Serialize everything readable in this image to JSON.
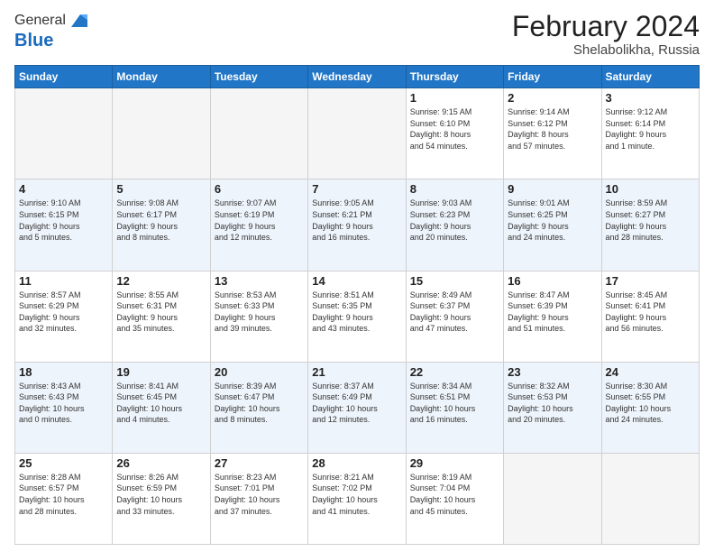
{
  "logo": {
    "general": "General",
    "blue": "Blue"
  },
  "header": {
    "title": "February 2024",
    "subtitle": "Shelabolikha, Russia"
  },
  "weekdays": [
    "Sunday",
    "Monday",
    "Tuesday",
    "Wednesday",
    "Thursday",
    "Friday",
    "Saturday"
  ],
  "weeks": [
    [
      {
        "day": "",
        "info": ""
      },
      {
        "day": "",
        "info": ""
      },
      {
        "day": "",
        "info": ""
      },
      {
        "day": "",
        "info": ""
      },
      {
        "day": "1",
        "info": "Sunrise: 9:15 AM\nSunset: 6:10 PM\nDaylight: 8 hours\nand 54 minutes."
      },
      {
        "day": "2",
        "info": "Sunrise: 9:14 AM\nSunset: 6:12 PM\nDaylight: 8 hours\nand 57 minutes."
      },
      {
        "day": "3",
        "info": "Sunrise: 9:12 AM\nSunset: 6:14 PM\nDaylight: 9 hours\nand 1 minute."
      }
    ],
    [
      {
        "day": "4",
        "info": "Sunrise: 9:10 AM\nSunset: 6:15 PM\nDaylight: 9 hours\nand 5 minutes."
      },
      {
        "day": "5",
        "info": "Sunrise: 9:08 AM\nSunset: 6:17 PM\nDaylight: 9 hours\nand 8 minutes."
      },
      {
        "day": "6",
        "info": "Sunrise: 9:07 AM\nSunset: 6:19 PM\nDaylight: 9 hours\nand 12 minutes."
      },
      {
        "day": "7",
        "info": "Sunrise: 9:05 AM\nSunset: 6:21 PM\nDaylight: 9 hours\nand 16 minutes."
      },
      {
        "day": "8",
        "info": "Sunrise: 9:03 AM\nSunset: 6:23 PM\nDaylight: 9 hours\nand 20 minutes."
      },
      {
        "day": "9",
        "info": "Sunrise: 9:01 AM\nSunset: 6:25 PM\nDaylight: 9 hours\nand 24 minutes."
      },
      {
        "day": "10",
        "info": "Sunrise: 8:59 AM\nSunset: 6:27 PM\nDaylight: 9 hours\nand 28 minutes."
      }
    ],
    [
      {
        "day": "11",
        "info": "Sunrise: 8:57 AM\nSunset: 6:29 PM\nDaylight: 9 hours\nand 32 minutes."
      },
      {
        "day": "12",
        "info": "Sunrise: 8:55 AM\nSunset: 6:31 PM\nDaylight: 9 hours\nand 35 minutes."
      },
      {
        "day": "13",
        "info": "Sunrise: 8:53 AM\nSunset: 6:33 PM\nDaylight: 9 hours\nand 39 minutes."
      },
      {
        "day": "14",
        "info": "Sunrise: 8:51 AM\nSunset: 6:35 PM\nDaylight: 9 hours\nand 43 minutes."
      },
      {
        "day": "15",
        "info": "Sunrise: 8:49 AM\nSunset: 6:37 PM\nDaylight: 9 hours\nand 47 minutes."
      },
      {
        "day": "16",
        "info": "Sunrise: 8:47 AM\nSunset: 6:39 PM\nDaylight: 9 hours\nand 51 minutes."
      },
      {
        "day": "17",
        "info": "Sunrise: 8:45 AM\nSunset: 6:41 PM\nDaylight: 9 hours\nand 56 minutes."
      }
    ],
    [
      {
        "day": "18",
        "info": "Sunrise: 8:43 AM\nSunset: 6:43 PM\nDaylight: 10 hours\nand 0 minutes."
      },
      {
        "day": "19",
        "info": "Sunrise: 8:41 AM\nSunset: 6:45 PM\nDaylight: 10 hours\nand 4 minutes."
      },
      {
        "day": "20",
        "info": "Sunrise: 8:39 AM\nSunset: 6:47 PM\nDaylight: 10 hours\nand 8 minutes."
      },
      {
        "day": "21",
        "info": "Sunrise: 8:37 AM\nSunset: 6:49 PM\nDaylight: 10 hours\nand 12 minutes."
      },
      {
        "day": "22",
        "info": "Sunrise: 8:34 AM\nSunset: 6:51 PM\nDaylight: 10 hours\nand 16 minutes."
      },
      {
        "day": "23",
        "info": "Sunrise: 8:32 AM\nSunset: 6:53 PM\nDaylight: 10 hours\nand 20 minutes."
      },
      {
        "day": "24",
        "info": "Sunrise: 8:30 AM\nSunset: 6:55 PM\nDaylight: 10 hours\nand 24 minutes."
      }
    ],
    [
      {
        "day": "25",
        "info": "Sunrise: 8:28 AM\nSunset: 6:57 PM\nDaylight: 10 hours\nand 28 minutes."
      },
      {
        "day": "26",
        "info": "Sunrise: 8:26 AM\nSunset: 6:59 PM\nDaylight: 10 hours\nand 33 minutes."
      },
      {
        "day": "27",
        "info": "Sunrise: 8:23 AM\nSunset: 7:01 PM\nDaylight: 10 hours\nand 37 minutes."
      },
      {
        "day": "28",
        "info": "Sunrise: 8:21 AM\nSunset: 7:02 PM\nDaylight: 10 hours\nand 41 minutes."
      },
      {
        "day": "29",
        "info": "Sunrise: 8:19 AM\nSunset: 7:04 PM\nDaylight: 10 hours\nand 45 minutes."
      },
      {
        "day": "",
        "info": ""
      },
      {
        "day": "",
        "info": ""
      }
    ]
  ]
}
